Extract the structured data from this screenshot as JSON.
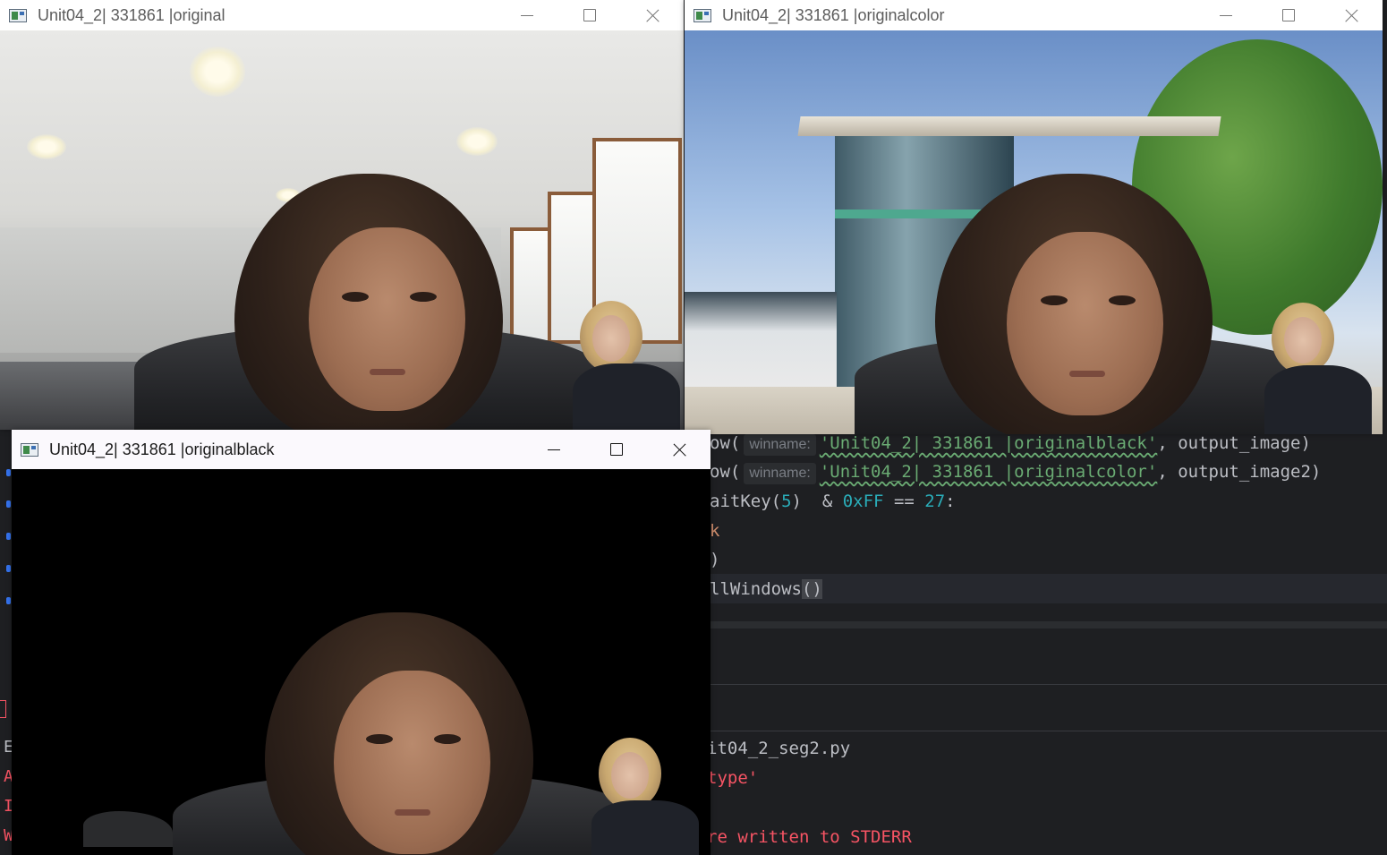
{
  "windows": {
    "original": {
      "title": "Unit04_2| 331861 |original"
    },
    "originalcolor": {
      "title": "Unit04_2| 331861 |originalcolor"
    },
    "originalblack": {
      "title": "Unit04_2| 331861 |originalblack"
    }
  },
  "editor": {
    "lines": [
      {
        "prefix": "ow(",
        "hint": "winname:",
        "string": "'Unit04_2| 331861 |originalblack'",
        "rest": ", output_image)"
      },
      {
        "prefix": "ow(",
        "hint": "winname:",
        "string": "'Unit04_2| 331861 |originalcolor'",
        "rest": ", output_image2)"
      }
    ],
    "waitkey_prefix": "aitKey(",
    "waitkey_arg": "5",
    "waitkey_mid": ")  & ",
    "waitkey_hex": "0xFF",
    "waitkey_eq": " == ",
    "waitkey_num": "27",
    "waitkey_end": ":",
    "break_fragment": "k",
    "paren_fragment": ")",
    "destroy_fragment": "llWindows",
    "destroy_parens": "()"
  },
  "console": {
    "script_line": "it04_2_seg2.py",
    "error_line": "type'",
    "stderr_line": "re written to STDERR",
    "left_letters": [
      "E",
      "A",
      "I",
      "W"
    ]
  }
}
